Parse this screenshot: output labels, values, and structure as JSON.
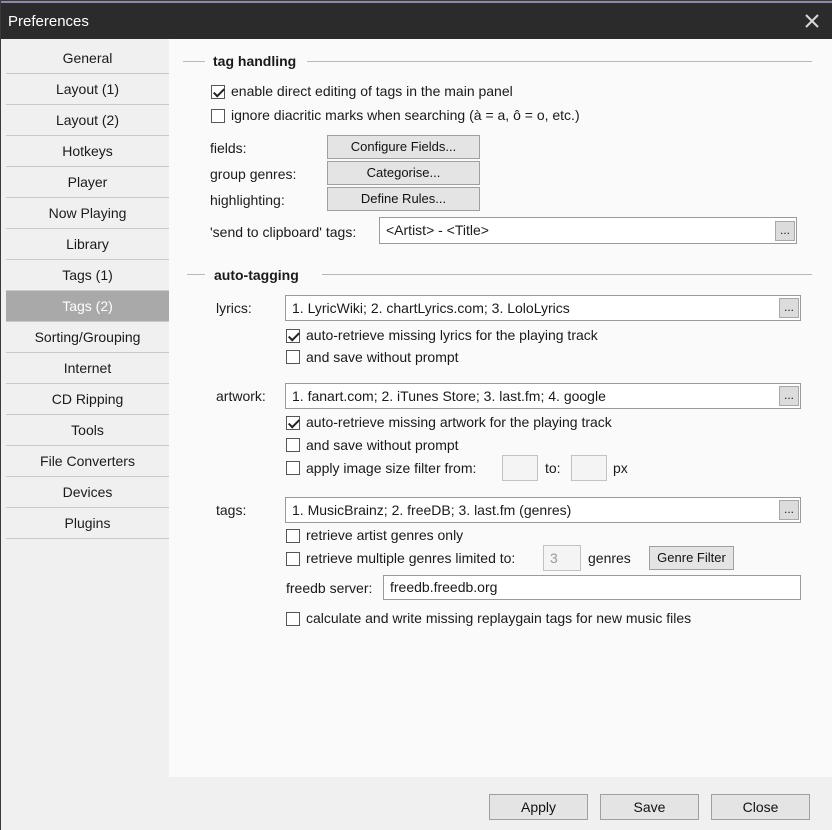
{
  "window": {
    "title": "Preferences"
  },
  "sidebar": {
    "items": [
      {
        "label": "General"
      },
      {
        "label": "Layout (1)"
      },
      {
        "label": "Layout (2)"
      },
      {
        "label": "Hotkeys"
      },
      {
        "label": "Player"
      },
      {
        "label": "Now Playing"
      },
      {
        "label": "Library"
      },
      {
        "label": "Tags (1)"
      },
      {
        "label": "Tags (2)"
      },
      {
        "label": "Sorting/Grouping"
      },
      {
        "label": "Internet"
      },
      {
        "label": "CD Ripping"
      },
      {
        "label": "Tools"
      },
      {
        "label": "File Converters"
      },
      {
        "label": "Devices"
      },
      {
        "label": "Plugins"
      }
    ],
    "selected": "Tags (2)"
  },
  "tag_handling": {
    "heading": "tag handling",
    "direct_edit": {
      "label": "enable direct editing of tags in the main panel",
      "checked": true
    },
    "ignore_diacritics": {
      "label": "ignore diacritic marks when searching (à = a, ô = o, etc.)",
      "checked": false
    },
    "fields_label": "fields:",
    "fields_button": "Configure Fields...",
    "group_genres_label": "group genres:",
    "group_genres_button": "Categorise...",
    "highlighting_label": "highlighting:",
    "highlighting_button": "Define Rules...",
    "clipboard_label": "'send to clipboard' tags:",
    "clipboard_value": "<Artist> - <Title>",
    "more_button": "..."
  },
  "auto_tagging": {
    "heading": "auto-tagging",
    "lyrics": {
      "label": "lyrics:",
      "value": "1. LyricWiki; 2. chartLyrics.com; 3. LoloLyrics",
      "auto_retrieve": {
        "label": "auto-retrieve missing lyrics for the playing track",
        "checked": true
      },
      "save_without_prompt": {
        "label": "and save without prompt",
        "checked": false
      }
    },
    "artwork": {
      "label": "artwork:",
      "value": "1. fanart.com; 2. iTunes Store; 3. last.fm; 4. google",
      "auto_retrieve": {
        "label": "auto-retrieve missing artwork for the playing track",
        "checked": true
      },
      "save_without_prompt": {
        "label": "and save without prompt",
        "checked": false
      },
      "size_filter": {
        "label": "apply image size filter from:",
        "checked": false,
        "from": "",
        "to_label": "to:",
        "to": "",
        "unit": "px"
      }
    },
    "tags": {
      "label": "tags:",
      "value": "1. MusicBrainz; 2. freeDB; 3. last.fm (genres)",
      "artist_genres_only": {
        "label": "retrieve artist genres only",
        "checked": false
      },
      "multiple_genres": {
        "label": "retrieve multiple genres limited to:",
        "checked": false,
        "limit": "3",
        "unit": "genres"
      },
      "genre_filter_button": "Genre Filter",
      "freedb_label": "freedb server:",
      "freedb_value": "freedb.freedb.org"
    },
    "replaygain": {
      "label": "calculate and write missing replaygain tags for new music files",
      "checked": false
    }
  },
  "footer": {
    "apply": "Apply",
    "save": "Save",
    "close": "Close"
  }
}
